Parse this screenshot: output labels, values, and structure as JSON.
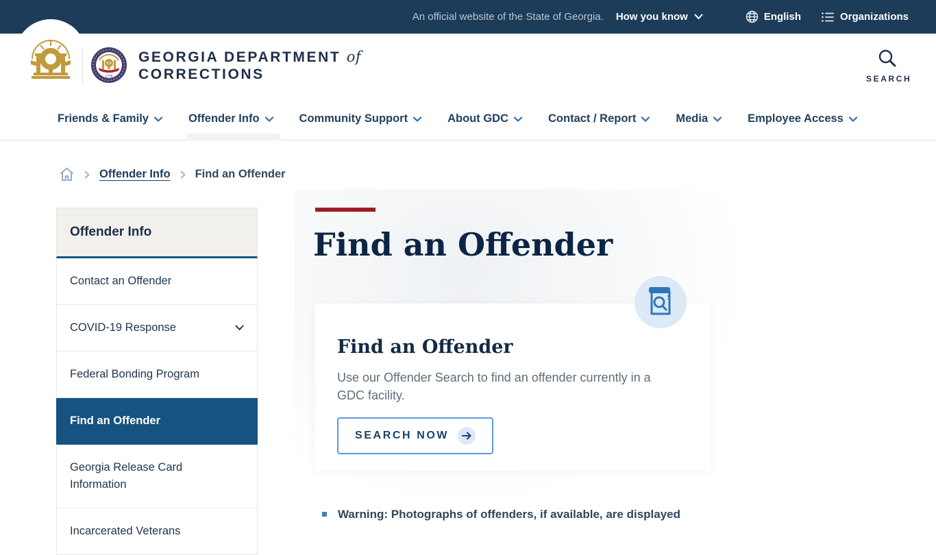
{
  "topbar": {
    "official_text": "An official website of the State of Georgia.",
    "how_you_know_label": "How you know",
    "language_label": "English",
    "organizations_label": "Organizations"
  },
  "header": {
    "org_name_line1": "GEORGIA DEPARTMENT",
    "org_name_connector": "of",
    "org_name_line2": "CORRECTIONS",
    "search_label": "SEARCH"
  },
  "nav": {
    "items": [
      {
        "label": "Friends & Family",
        "active": false
      },
      {
        "label": "Offender Info",
        "active": true
      },
      {
        "label": "Community Support",
        "active": false
      },
      {
        "label": "About GDC",
        "active": false
      },
      {
        "label": "Contact / Report",
        "active": false
      },
      {
        "label": "Media",
        "active": false
      },
      {
        "label": "Employee Access",
        "active": false
      }
    ]
  },
  "breadcrumb": {
    "link": "Offender Info",
    "current": "Find an Offender"
  },
  "sidebar": {
    "title": "Offender Info",
    "items": [
      {
        "label": "Contact an Offender",
        "active": false,
        "expandable": false
      },
      {
        "label": "COVID-19 Response",
        "active": false,
        "expandable": true
      },
      {
        "label": "Federal Bonding Program",
        "active": false,
        "expandable": false
      },
      {
        "label": "Find an Offender",
        "active": true,
        "expandable": false
      },
      {
        "label": "Georgia Release Card Information",
        "active": false,
        "expandable": false
      },
      {
        "label": "Incarcerated Veterans",
        "active": false,
        "expandable": false
      }
    ]
  },
  "main": {
    "page_title": "Find an Offender",
    "card": {
      "title": "Find an Offender",
      "body": "Use our Offender Search to find an offender currently in a GDC facility.",
      "cta_label": "SEARCH NOW"
    },
    "warning_text": "Warning: Photographs of offenders, if available, are displayed"
  },
  "colors": {
    "topbar_navy": "#1d3c59",
    "active_sidebar_blue": "#175280",
    "accent_red": "#a01d24",
    "heading_navy": "#0c2544",
    "cta_border_blue": "#5a9ad6",
    "icon_blue": "#2f76b8",
    "icon_badge_bg": "#dce9f7",
    "gold_logo": "#c19a3d"
  }
}
